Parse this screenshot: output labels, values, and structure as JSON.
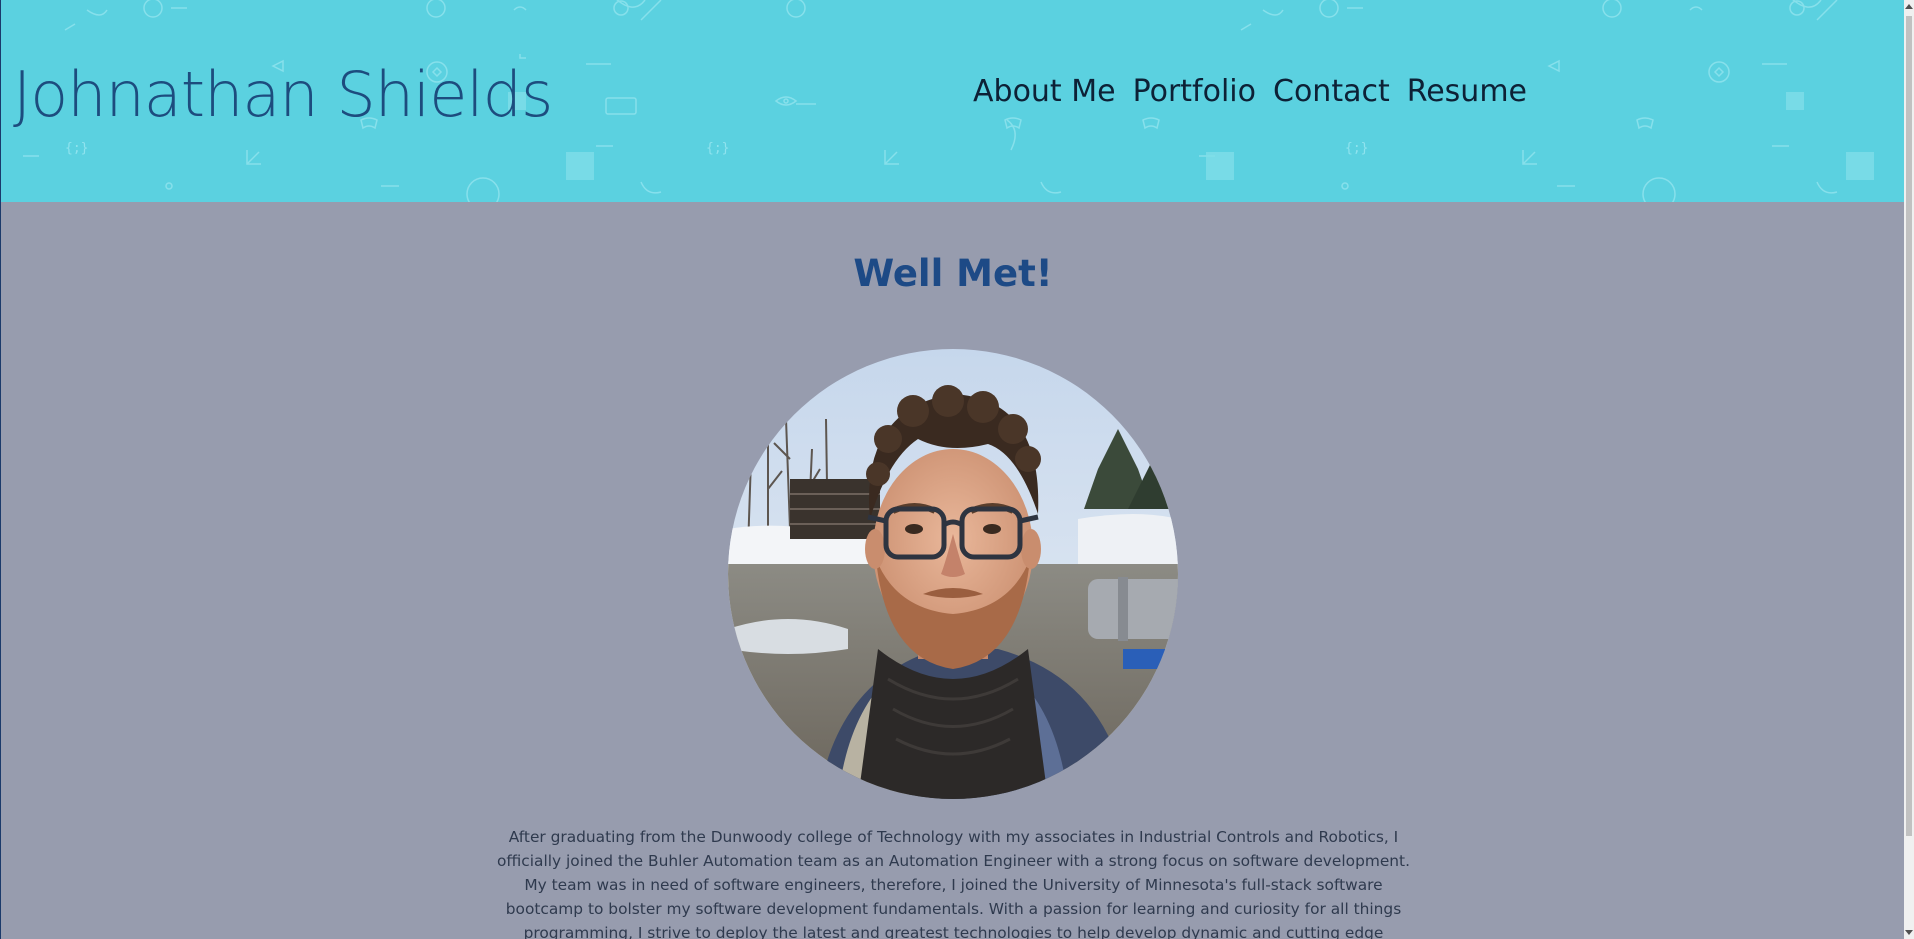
{
  "header": {
    "title": "Johnathan Shields",
    "background_color": "#5bd1e0",
    "nav": {
      "about": "About Me",
      "portfolio": "Portfolio",
      "contact": "Contact",
      "resume": "Resume"
    }
  },
  "main": {
    "heading": "Well Met!",
    "bio": "After graduating from the Dunwoody college of Technology with my associates in Industrial Controls and Robotics, I officially joined the Buhler Automation team as an Automation Engineer with a strong focus on software development. My team was in need of software engineers, therefore, I joined the University of Minnesota's full-stack software bootcamp to bolster my software development fundamentals. With a passion for learning and curiosity for all things programming, I strive to deploy the latest and greatest technologies to help develop dynamic and cutting edge applications for our customers at Buhler!",
    "background_color": "#979cae",
    "heading_color": "#1d4a86"
  }
}
